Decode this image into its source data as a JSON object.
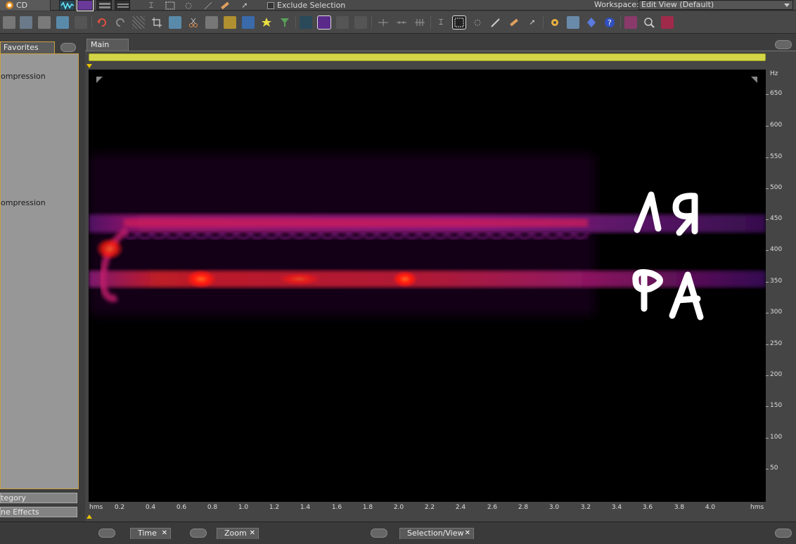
{
  "topbar": {
    "cd_label": "CD",
    "exclude_selection": "Exclude Selection",
    "workspace_label": "Workspace:",
    "workspace_value": "Edit View (Default)"
  },
  "left_panel": {
    "tab_label": "Favorites",
    "items": [
      "ompression",
      "ompression"
    ],
    "buttons": [
      "tegory",
      "ne Effects"
    ]
  },
  "main_panel": {
    "tab_label": "Main",
    "annotations": [
      "ЛЯ",
      "ФА"
    ]
  },
  "hz_ruler": {
    "unit": "Hz",
    "ticks": [
      "650",
      "600",
      "550",
      "500",
      "450",
      "400",
      "350",
      "300",
      "250",
      "200",
      "150",
      "100",
      "50"
    ]
  },
  "time_ruler": {
    "unit_left": "hms",
    "unit_right": "hms",
    "ticks": [
      "0.2",
      "0.4",
      "0.6",
      "0.8",
      "1.0",
      "1.2",
      "1.4",
      "1.6",
      "1.8",
      "2.0",
      "2.2",
      "2.4",
      "2.6",
      "2.8",
      "3.0",
      "3.2",
      "3.4",
      "3.6",
      "3.8",
      "4.0"
    ]
  },
  "bottom_tabs": [
    {
      "label": "Time"
    },
    {
      "label": "Zoom"
    },
    {
      "label": "Selection/View"
    }
  ],
  "colors": {
    "accent": "#c9a040",
    "overview": "#d4d648",
    "spectral_hot": "#ff2000",
    "spectral_mid": "#9a1a8a",
    "spectral_low": "#3a0a4a"
  }
}
